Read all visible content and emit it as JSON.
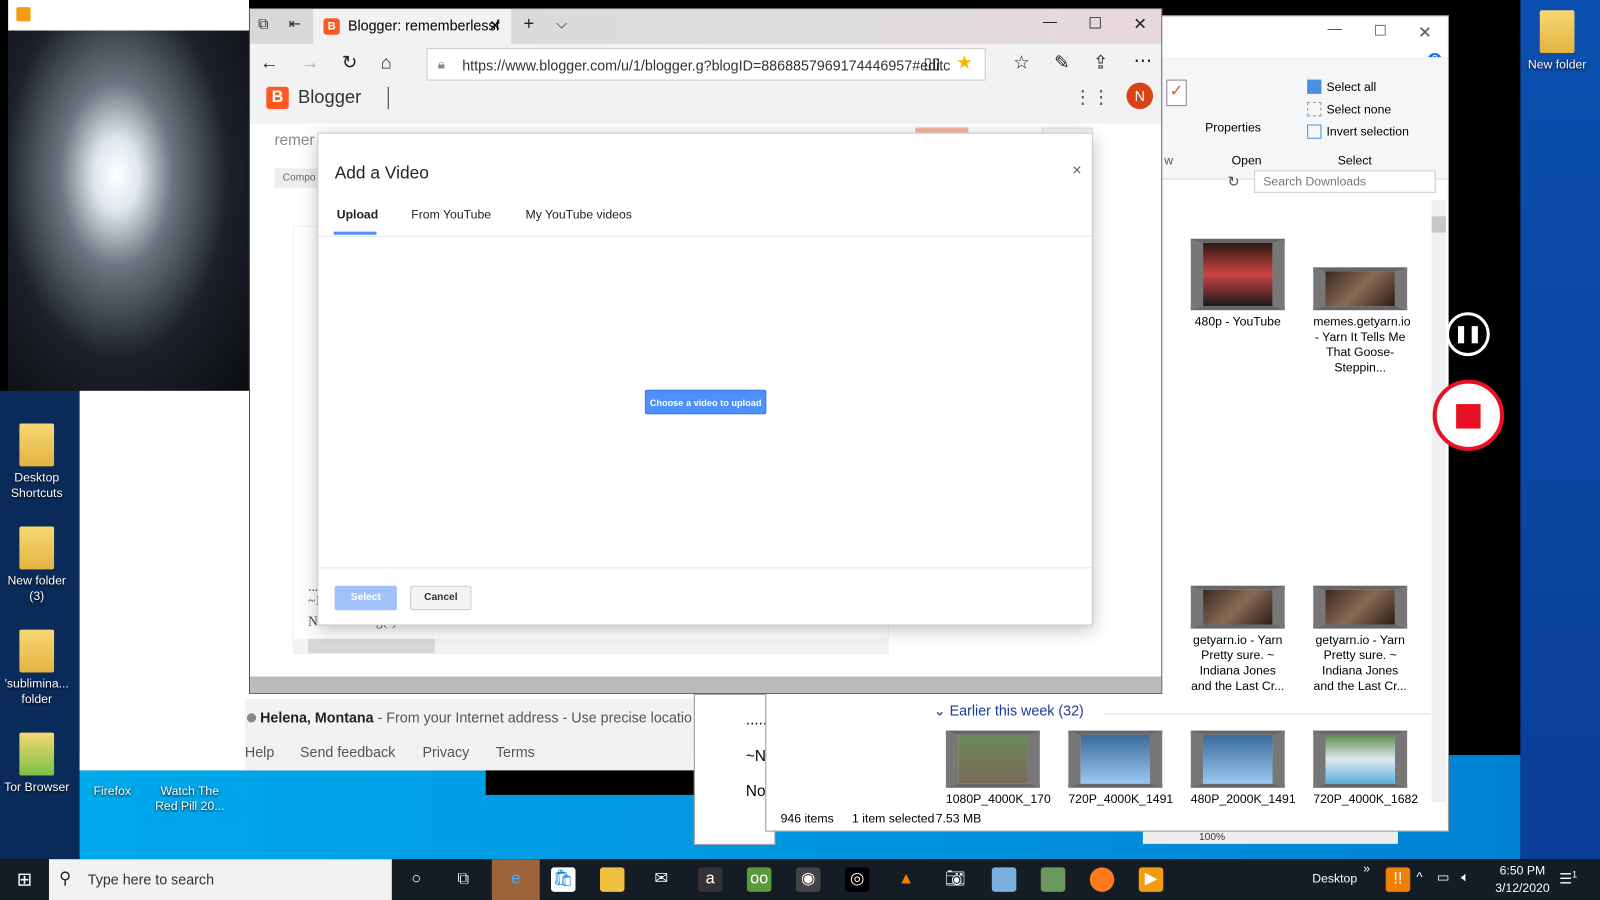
{
  "desktop": {
    "icons": [
      {
        "label": "Desktop Shortcuts"
      },
      {
        "label": "New folder (3)"
      },
      {
        "label": "'sublimina... folder"
      },
      {
        "label": "Tor Browser"
      },
      {
        "label": "Firefox"
      },
      {
        "label": "Watch The Red Pill 20..."
      },
      {
        "label": "New folder"
      }
    ]
  },
  "browser": {
    "tab_title": "Blogger: rememberlessf",
    "url": "https://www.blogger.com/u/1/blogger.g?blogID=8868857969174446957#editc",
    "app_name": "Blogger",
    "avatar_letter": "N",
    "blog_title_partial": "remer",
    "compose_partial": "Compo",
    "close_label": "Close",
    "editor_lines": [
      "...",
      "~I",
      "No such thing(s)."
    ],
    "accent": "#ff5722"
  },
  "modal": {
    "title": "Add a Video",
    "tabs": [
      {
        "label": "Upload",
        "active": true
      },
      {
        "label": "From YouTube",
        "active": false
      },
      {
        "label": "My YouTube videos",
        "active": false
      }
    ],
    "choose_button": "Choose a video to upload",
    "select_button": "Select",
    "cancel_button": "Cancel",
    "close_glyph": "×"
  },
  "google_page": {
    "location_bold": "Helena, Montana",
    "location_rest": " - From your Internet address - Use precise locatio",
    "footer_links": [
      "Help",
      "Send feedback",
      "Privacy",
      "Terms"
    ]
  },
  "other_window": {
    "lines": [
      "........",
      "~N",
      "No"
    ]
  },
  "explorer": {
    "ribbon": {
      "open_group": "Open",
      "select_group": "Select",
      "view_group_partial": "w",
      "properties": "Properties",
      "select_all": "Select all",
      "select_none": "Select none",
      "invert_selection": "Invert selection"
    },
    "search_placeholder": "Search Downloads",
    "files_top": [
      {
        "name": "480p - YouTube"
      },
      {
        "name": "memes.getyarn.io - Yarn  It Tells Me That Goose-Steppin..."
      }
    ],
    "files_mid": [
      {
        "name": "getyarn.io - Yarn Pretty sure. ~ Indiana Jones and the Last Cr..."
      },
      {
        "name": "getyarn.io - Yarn Pretty sure. ~ Indiana Jones and the Last Cr..."
      }
    ],
    "group_header": "Earlier this week (32)",
    "files_bottom": [
      {
        "name": "1080P_4000K_170"
      },
      {
        "name": "720P_4000K_1491"
      },
      {
        "name": "480P_2000K_1491"
      },
      {
        "name": "720P_4000K_1682"
      }
    ],
    "status": {
      "items": "946 items",
      "selected": "1 item selected",
      "size": "7.53 MB"
    },
    "zoom_partial": "100%"
  },
  "taskbar": {
    "search_placeholder": "Type here to search",
    "desktop_label": "Desktop",
    "time": "6:50 PM",
    "date": "3/12/2020",
    "notification_count": "1"
  }
}
